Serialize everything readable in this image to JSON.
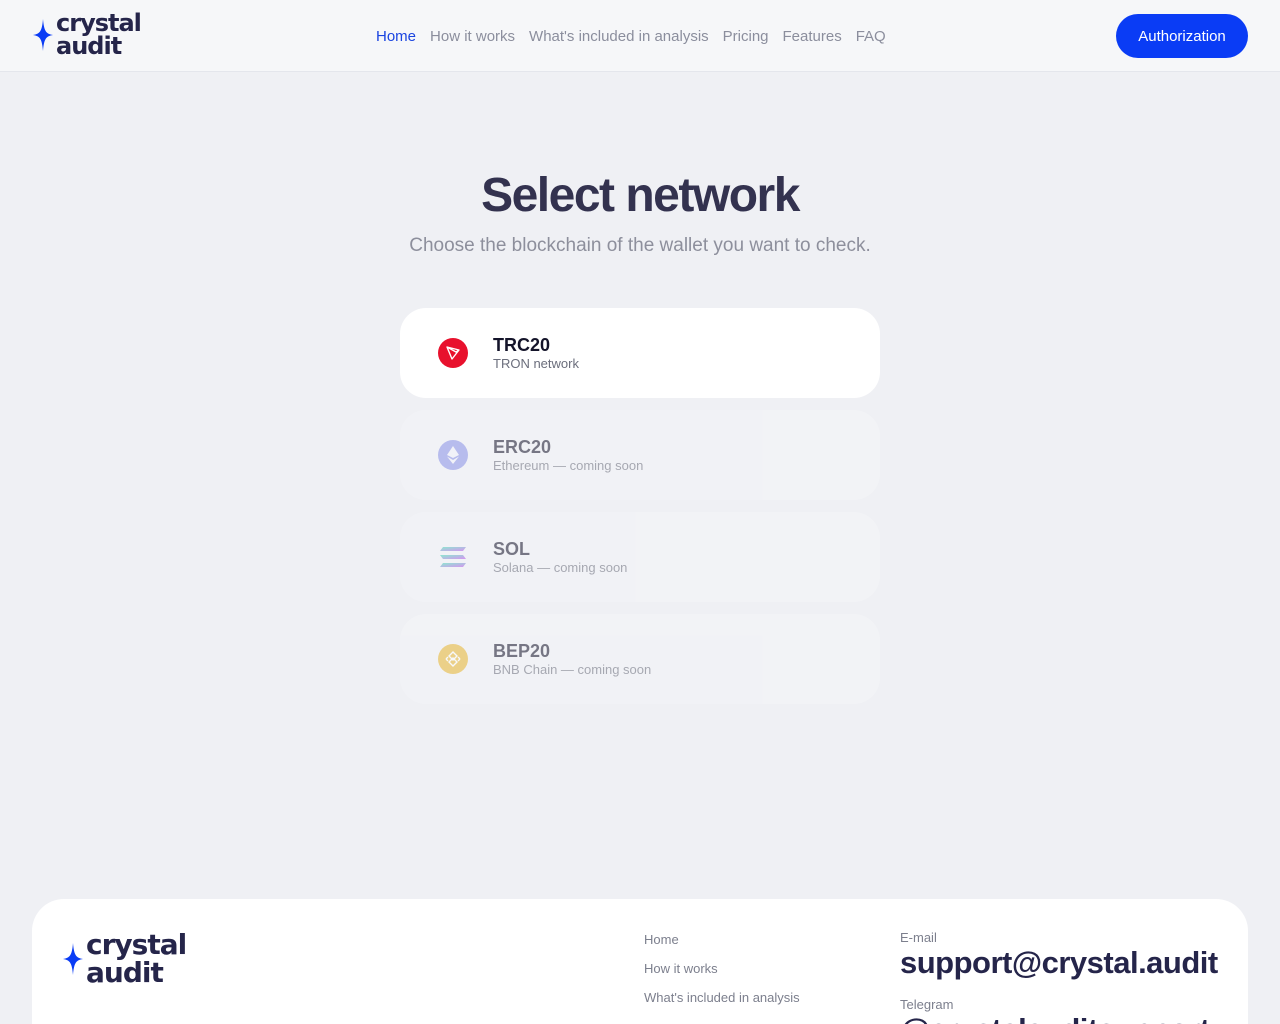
{
  "brand": {
    "line1": "crystal",
    "line2": "audit"
  },
  "nav": {
    "items": [
      {
        "label": "Home",
        "active": true
      },
      {
        "label": "How it works",
        "active": false
      },
      {
        "label": "What's included in analysis",
        "active": false
      },
      {
        "label": "Pricing",
        "active": false
      },
      {
        "label": "Features",
        "active": false
      },
      {
        "label": "FAQ",
        "active": false
      }
    ],
    "auth_label": "Authorization"
  },
  "main": {
    "title": "Select network",
    "subtitle": "Choose the blockchain of the wallet you want to check.",
    "networks": [
      {
        "name": "TRC20",
        "description": "TRON network",
        "icon": "tron-icon",
        "color": "#e8112d",
        "enabled": true
      },
      {
        "name": "ERC20",
        "description": "Ethereum — coming soon",
        "icon": "ethereum-icon",
        "color": "#8a92e8",
        "enabled": false
      },
      {
        "name": "SOL",
        "description": "Solana — coming soon",
        "icon": "solana-icon",
        "color": "#9b6cf0",
        "enabled": false
      },
      {
        "name": "BEP20",
        "description": "BNB Chain — coming soon",
        "icon": "bnb-icon",
        "color": "#e9b730",
        "enabled": false
      }
    ]
  },
  "footer": {
    "links": [
      "Home",
      "How it works",
      "What's included in analysis"
    ],
    "email_label": "E-mail",
    "email": "support@crystal.audit",
    "telegram_label": "Telegram",
    "telegram": "@crystalauditsupport"
  },
  "colors": {
    "accent": "#0a3cf5",
    "background": "#eff0f4",
    "text_dark": "#33324f"
  }
}
